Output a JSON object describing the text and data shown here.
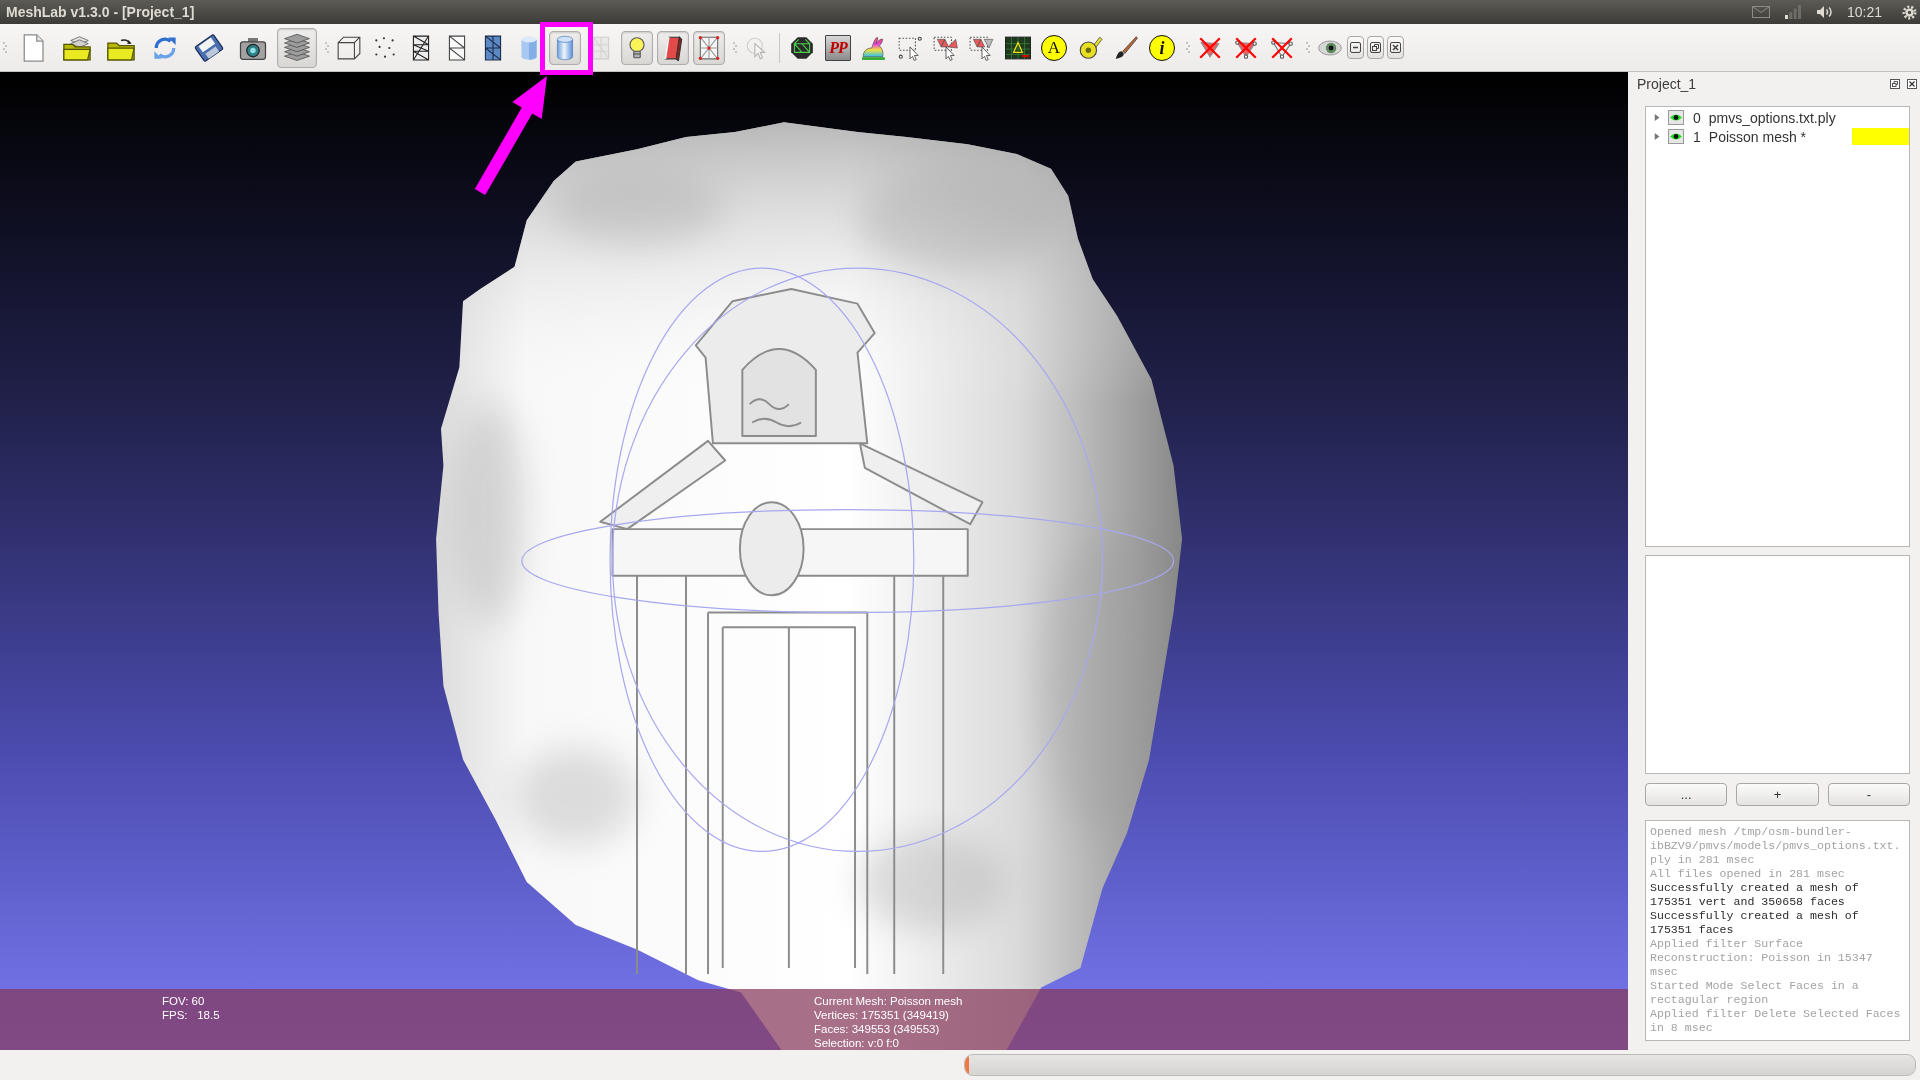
{
  "top_panel": {
    "title": "MeshLab v1.3.0 - [Project_1]",
    "clock": "10:21"
  },
  "toolbars": [
    {
      "sections": [
        [
          {
            "kind": "document",
            "pressed": false,
            "disabled": false,
            "highlighted": false
          },
          {
            "kind": "projectfolder",
            "pressed": false,
            "disabled": false,
            "highlighted": false
          },
          {
            "kind": "folder",
            "pressed": false,
            "disabled": false,
            "highlighted": false
          },
          {
            "kind": "reload",
            "pressed": false,
            "disabled": false,
            "highlighted": false
          },
          {
            "kind": "save",
            "pressed": false,
            "disabled": false,
            "highlighted": false
          },
          {
            "kind": "camera",
            "pressed": false,
            "disabled": false,
            "highlighted": false
          },
          {
            "kind": "layers",
            "pressed": true,
            "disabled": false,
            "highlighted": false
          }
        ]
      ]
    },
    {
      "sections": [
        [
          {
            "kind": "box",
            "pressed": false,
            "disabled": false,
            "highlighted": false
          },
          {
            "kind": "points",
            "pressed": false,
            "disabled": false,
            "highlighted": false
          },
          {
            "kind": "wireframe",
            "pressed": false,
            "disabled": false,
            "highlighted": false
          },
          {
            "kind": "hiddenlines",
            "pressed": false,
            "disabled": false,
            "highlighted": false
          },
          {
            "kind": "flatlines",
            "pressed": false,
            "disabled": false,
            "highlighted": false
          },
          {
            "kind": "flat",
            "pressed": false,
            "disabled": false,
            "highlighted": false
          },
          {
            "kind": "smooth",
            "pressed": true,
            "disabled": false,
            "highlighted": true
          },
          {
            "kind": "texture",
            "pressed": false,
            "disabled": true,
            "highlighted": false
          },
          {
            "kind": "bulb",
            "pressed": true,
            "disabled": false,
            "highlighted": false
          },
          {
            "kind": "doubleside",
            "pressed": true,
            "disabled": false,
            "highlighted": false
          },
          {
            "kind": "redwire",
            "pressed": true,
            "disabled": false,
            "highlighted": false
          }
        ]
      ]
    },
    {
      "sections": [
        [
          {
            "kind": "cursor",
            "pressed": false,
            "disabled": true,
            "highlighted": false
          }
        ],
        [
          {
            "kind": "sphere",
            "pressed": false,
            "disabled": false,
            "highlighted": false
          },
          {
            "kind": "glyphtile",
            "glyph": "PP",
            "pressed": false,
            "disabled": false,
            "highlighted": false
          },
          {
            "kind": "bunny",
            "pressed": false,
            "disabled": false,
            "highlighted": false
          },
          {
            "kind": "selectvert",
            "pressed": false,
            "disabled": false,
            "highlighted": false
          },
          {
            "kind": "selectface",
            "pressed": false,
            "disabled": false,
            "highlighted": false
          },
          {
            "kind": "selectconnected",
            "pressed": false,
            "disabled": false,
            "highlighted": false
          },
          {
            "kind": "screen",
            "pressed": false,
            "disabled": false,
            "highlighted": false
          },
          {
            "kind": "glyphcircle",
            "glyph": "A",
            "pressed": false,
            "disabled": false,
            "highlighted": false
          },
          {
            "kind": "tape",
            "pressed": false,
            "disabled": false,
            "highlighted": false
          },
          {
            "kind": "brush",
            "pressed": false,
            "disabled": false,
            "highlighted": false
          },
          {
            "kind": "glyphinfo",
            "glyph": "i",
            "pressed": false,
            "disabled": false,
            "highlighted": false
          }
        ]
      ]
    },
    {
      "sections": [
        [
          {
            "kind": "deletevert",
            "pressed": false,
            "disabled": false,
            "highlighted": false
          },
          {
            "kind": "deleteface",
            "pressed": false,
            "disabled": false,
            "highlighted": false
          },
          {
            "kind": "deleteall",
            "pressed": false,
            "disabled": false,
            "highlighted": false
          }
        ]
      ]
    },
    {
      "sections": [
        [
          {
            "kind": "eye",
            "pressed": false,
            "disabled": false,
            "highlighted": false
          }
        ]
      ]
    }
  ],
  "window_controls": [
    {
      "kind": "minimize"
    },
    {
      "kind": "restore"
    },
    {
      "kind": "close"
    }
  ],
  "viewport": {
    "overlay": {
      "left": [
        "FOV: 60",
        "FPS:   18.5"
      ],
      "center": [
        "Current Mesh: Poisson mesh",
        "Vertices: 175351 (349419)",
        "Faces: 349553 (349553)",
        "Selection: v:0 f:0"
      ]
    }
  },
  "layer_panel": {
    "title": "Project_1",
    "layers": [
      {
        "index": "0",
        "name": "pmvs_options.txt.ply",
        "expanded": false,
        "visible": true,
        "selected": false
      },
      {
        "index": "1",
        "name": "Poisson mesh *",
        "expanded": false,
        "visible": true,
        "selected": true
      }
    ],
    "buttons": [
      "...",
      "+",
      "-"
    ],
    "log": [
      {
        "kind": "system",
        "text": "Opened mesh /tmp/osm-bundler-ibBZV9/pmvs/models/pmvs_options.txt.ply in 281 msec"
      },
      {
        "kind": "system",
        "text": "All files opened in 281 msec"
      },
      {
        "kind": "filter",
        "text": "Successfully created a mesh of 175351 vert and 350658 faces"
      },
      {
        "kind": "filter",
        "text": "Successfully created a mesh of 175351 faces"
      },
      {
        "kind": "system",
        "text": "Applied filter Surface Reconstruction: Poisson in 15347 msec"
      },
      {
        "kind": "system",
        "text": "Started Mode Select Faces in a rectagular region"
      },
      {
        "kind": "system",
        "text": "Applied filter Delete Selected Faces in 8 msec"
      }
    ]
  },
  "status_bar": {
    "progress": {
      "level": 0.004
    }
  }
}
